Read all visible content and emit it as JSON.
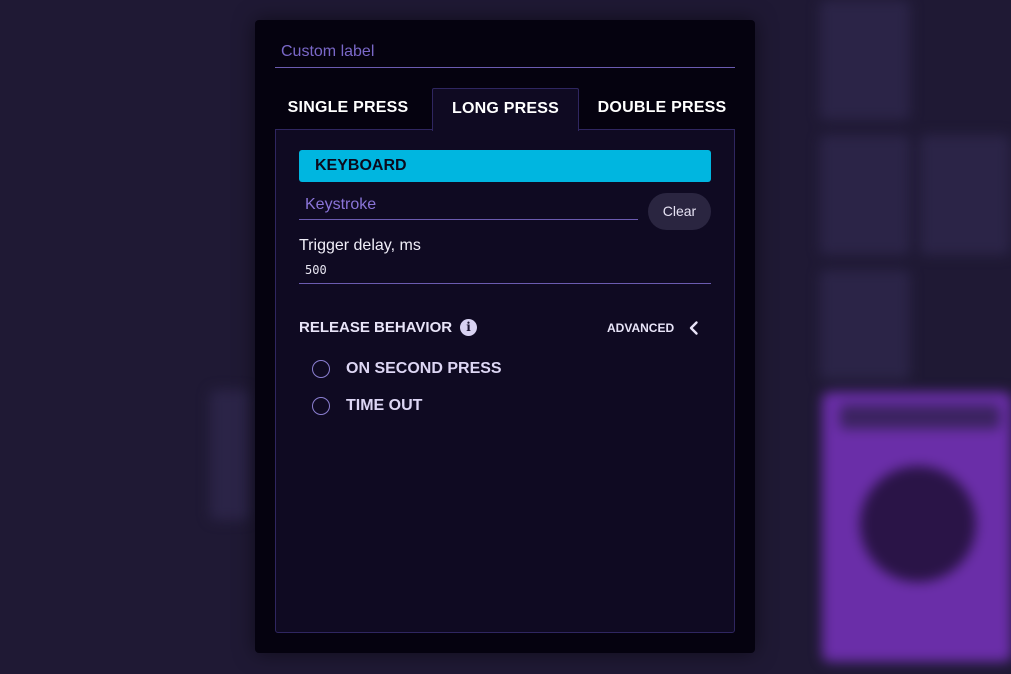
{
  "modal": {
    "custom_label_placeholder": "Custom label",
    "tabs": [
      {
        "label": "SINGLE PRESS",
        "active": false
      },
      {
        "label": "LONG PRESS",
        "active": true
      },
      {
        "label": "DOUBLE PRESS",
        "active": false
      }
    ],
    "action": {
      "type_label": "KEYBOARD",
      "keystroke_placeholder": "Keystroke",
      "clear_label": "Clear"
    },
    "trigger_delay": {
      "label": "Trigger delay, ms",
      "value": "500"
    },
    "release_behavior": {
      "title": "RELEASE BEHAVIOR",
      "info_icon": "info-icon",
      "advanced_label": "ADVANCED",
      "advanced_icon": "chevron-left-icon",
      "options": [
        {
          "label": "ON SECOND PRESS",
          "selected": false
        },
        {
          "label": "TIME OUT",
          "selected": false
        }
      ]
    }
  },
  "colors": {
    "accent": "#00b6e0",
    "panel": "#0f0a22",
    "modal": "#05020f",
    "background": "#1f1934",
    "background_purple": "#6a2ea8"
  }
}
